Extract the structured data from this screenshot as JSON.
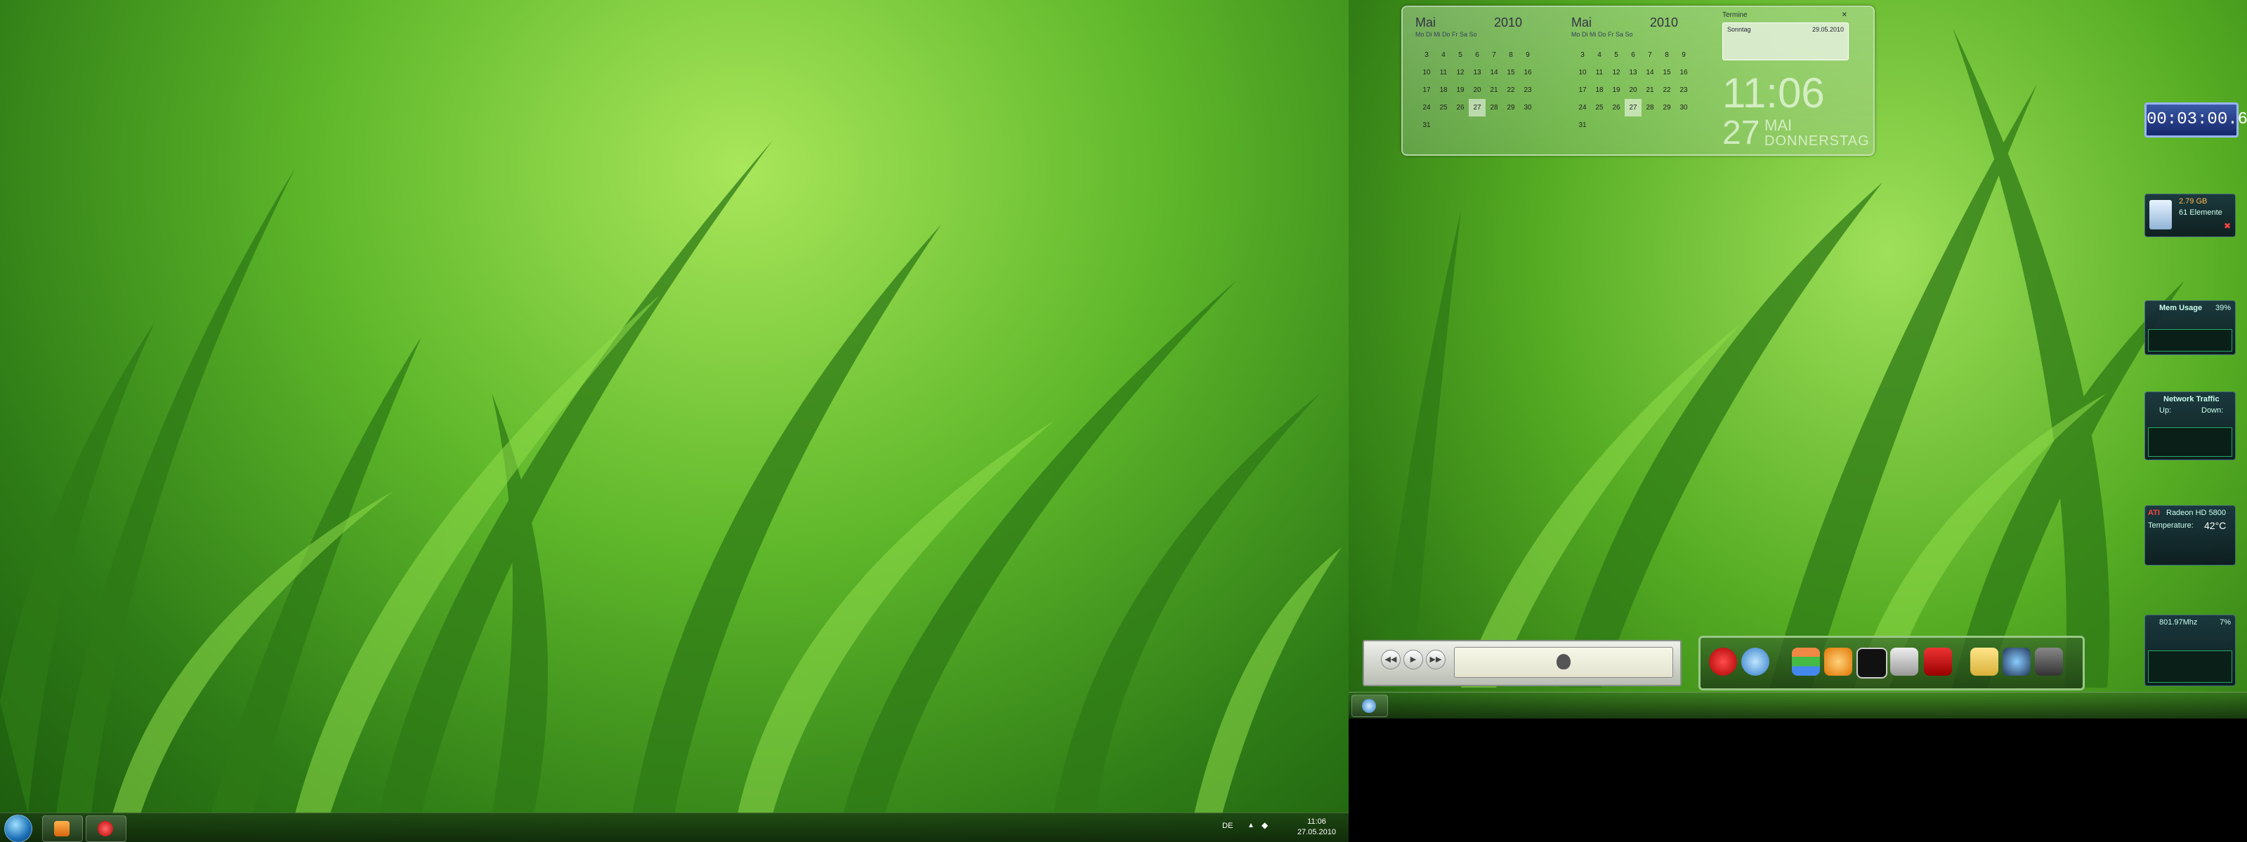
{
  "left_taskbar": {
    "language": "DE",
    "clock_time": "11:06",
    "clock_date": "27.05.2010"
  },
  "calendar": {
    "left": {
      "month": "Mai",
      "year": "2010",
      "weekdays": "Mo Di Mi Do Fr Sa So",
      "days": [
        "3",
        "4",
        "5",
        "6",
        "7",
        "8",
        "9",
        "10",
        "11",
        "12",
        "13",
        "14",
        "15",
        "16",
        "17",
        "18",
        "19",
        "20",
        "21",
        "22",
        "23",
        "24",
        "25",
        "26",
        "27",
        "28",
        "29",
        "30",
        "31"
      ]
    },
    "right": {
      "month": "Mai",
      "year": "2010",
      "weekdays": "Mo Di Mi Do Fr Sa So",
      "days": [
        "3",
        "4",
        "5",
        "6",
        "7",
        "8",
        "9",
        "10",
        "11",
        "12",
        "13",
        "14",
        "15",
        "16",
        "17",
        "18",
        "19",
        "20",
        "21",
        "22",
        "23",
        "24",
        "25",
        "26",
        "27",
        "28",
        "29",
        "30",
        "31"
      ]
    },
    "appointments_title": "Termine",
    "appointment_day": "Sonntag",
    "appointment_date": "29.05.2010",
    "big_time": "11:06",
    "big_day_number": "27",
    "big_month": "MAI",
    "big_weekday": "DONNERSTAG"
  },
  "stopwatch": {
    "value": "00:03:00.6"
  },
  "recycle_bin": {
    "size": "2.79 GB",
    "items": "61 Elemente"
  },
  "mem_usage": {
    "title": "Mem Usage",
    "percent": "39%"
  },
  "network": {
    "title": "Network Traffic",
    "up_label": "Up:",
    "down_label": "Down:"
  },
  "gpu": {
    "brand": "ATI",
    "name": "Radeon HD 5800",
    "temp_label": "Temperature:",
    "temp_value": "42°C"
  },
  "cpu": {
    "clock": "801.97Mhz",
    "percent": "7%"
  },
  "colors": {
    "accent": "#9ac785",
    "stopwatch_bg": "#1e3386"
  }
}
